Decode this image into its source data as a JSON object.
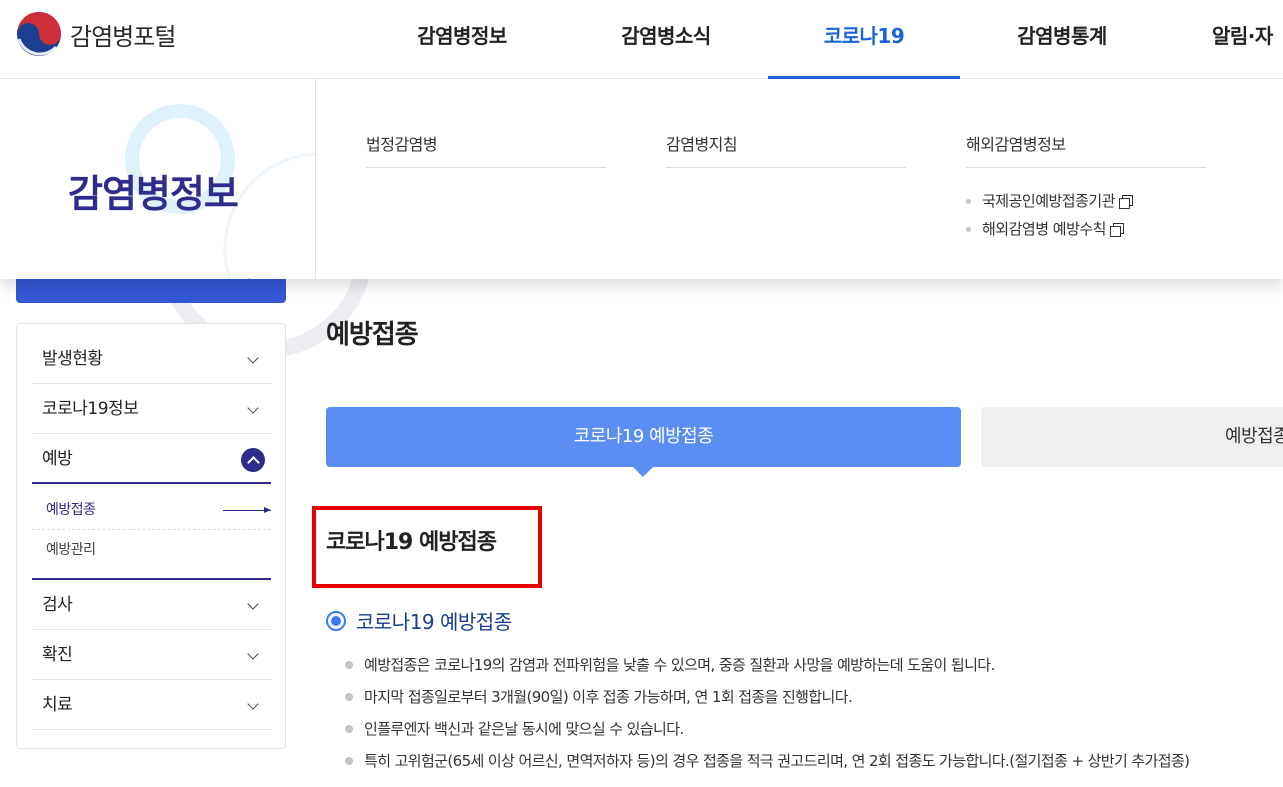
{
  "header": {
    "logo_text": "감염병포털",
    "nav": [
      {
        "label": "감염병정보",
        "active": false
      },
      {
        "label": "감염병소식",
        "active": false
      },
      {
        "label": "코로나19",
        "active": true
      },
      {
        "label": "감염병통계",
        "active": false
      },
      {
        "label": "알림·자",
        "active": false
      }
    ]
  },
  "mega_menu": {
    "title": "감염병정보",
    "columns": [
      {
        "title": "법정감염병",
        "items": []
      },
      {
        "title": "감염병지침",
        "items": []
      },
      {
        "title": "해외감염병정보",
        "items": [
          "국제공인예방접종기관",
          "해외감염병 예방수칙"
        ]
      }
    ]
  },
  "sidebar": {
    "items": [
      {
        "label": "발생현황"
      },
      {
        "label": "코로나19정보"
      },
      {
        "label": "예방",
        "open": true,
        "sub": [
          "예방접종",
          "예방관리"
        ]
      },
      {
        "label": "검사"
      },
      {
        "label": "확진"
      },
      {
        "label": "치료"
      }
    ]
  },
  "main": {
    "page_title": "예방접종",
    "tabs": [
      {
        "label": "코로나19 예방접종",
        "active": true
      },
      {
        "label": "예방접종",
        "active": false
      }
    ],
    "section_title": "코로나19 예방접종",
    "sub_heading": "코로나19 예방접종",
    "bullets": [
      "예방접종은 코로나19의 감염과 전파위험을 낮출 수 있으며, 중증 질환과 사망을 예방하는데 도움이 됩니다.",
      "마지막 접종일로부터 3개월(90일) 이후 접종 가능하며, 연 1회 접종을 진행합니다.",
      "인플루엔자 백신과 같은날 동시에 맞으실 수 있습니다.",
      "특히 고위험군(65세 이상 어르신, 면역저하자 등)의 경우 접종을 적극 권고드리며, 연 2회 접종도 가능합니다.(절기접종 + 상반기 추가접종)"
    ]
  },
  "colors": {
    "accent_blue": "#1b63d6",
    "navy": "#2f2c8c",
    "tab_active": "#5b8ef2",
    "highlight_red": "#e60000"
  }
}
